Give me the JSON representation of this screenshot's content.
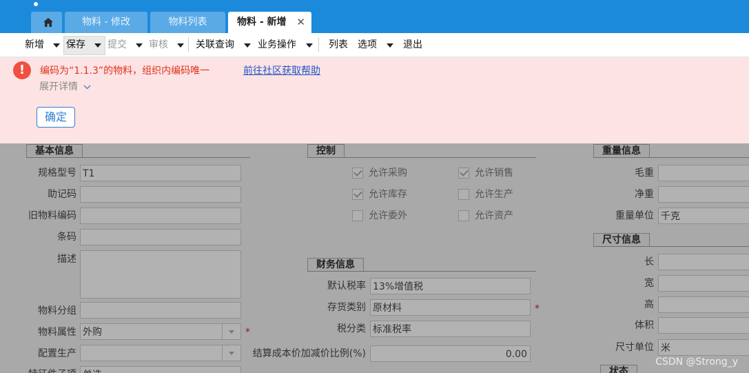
{
  "tabs": [
    {
      "label": "物料 - 修改"
    },
    {
      "label": "物料列表"
    },
    {
      "label": "物料 - 新增"
    }
  ],
  "toolbar": {
    "new": "新增",
    "save": "保存",
    "submit": "提交",
    "audit": "审核",
    "related_query": "关联查询",
    "business_ops": "业务操作",
    "list": "列表",
    "options": "选项",
    "exit": "退出"
  },
  "alert": {
    "message": "编码为“1.1.3”的物料，组织内编码唯一",
    "help_link": "前往社区获取帮助",
    "details": "展开详情",
    "ok": "确定"
  },
  "basic": {
    "title": "基本信息",
    "spec_label": "规格型号",
    "spec_value": "T1",
    "mnemonic_label": "助记码",
    "old_code_label": "旧物料编码",
    "barcode_label": "条码",
    "desc_label": "描述",
    "group_label": "物料分组",
    "attr_label": "物料属性",
    "attr_value": "外购",
    "config_label": "配置生产",
    "feature_label": "特征件子项",
    "feature_value": "单选"
  },
  "control": {
    "title": "控制",
    "items": [
      {
        "label": "允许采购",
        "checked": true
      },
      {
        "label": "允许销售",
        "checked": true
      },
      {
        "label": "允许库存",
        "checked": true
      },
      {
        "label": "允许生产",
        "checked": false
      },
      {
        "label": "允许委外",
        "checked": false
      },
      {
        "label": "允许资产",
        "checked": false
      }
    ]
  },
  "finance": {
    "title": "财务信息",
    "tax_rate_label": "默认税率",
    "tax_rate_value": "13%增值税",
    "inv_cat_label": "存货类别",
    "inv_cat_value": "原材料",
    "tax_class_label": "税分类",
    "tax_class_value": "标准税率",
    "ratio_label": "结算成本价加减价比例(%)",
    "ratio_value": "0.00"
  },
  "weight": {
    "title": "重量信息",
    "gross_label": "毛重",
    "net_label": "净重",
    "unit_label": "重量单位",
    "unit_value": "千克"
  },
  "size": {
    "title": "尺寸信息",
    "length_label": "长",
    "width_label": "宽",
    "height_label": "高",
    "volume_label": "体积",
    "unit_label": "尺寸单位",
    "unit_value": "米"
  },
  "status": {
    "title": "状态"
  },
  "required_mark": "*",
  "watermark": "CSDN @Strong_y"
}
